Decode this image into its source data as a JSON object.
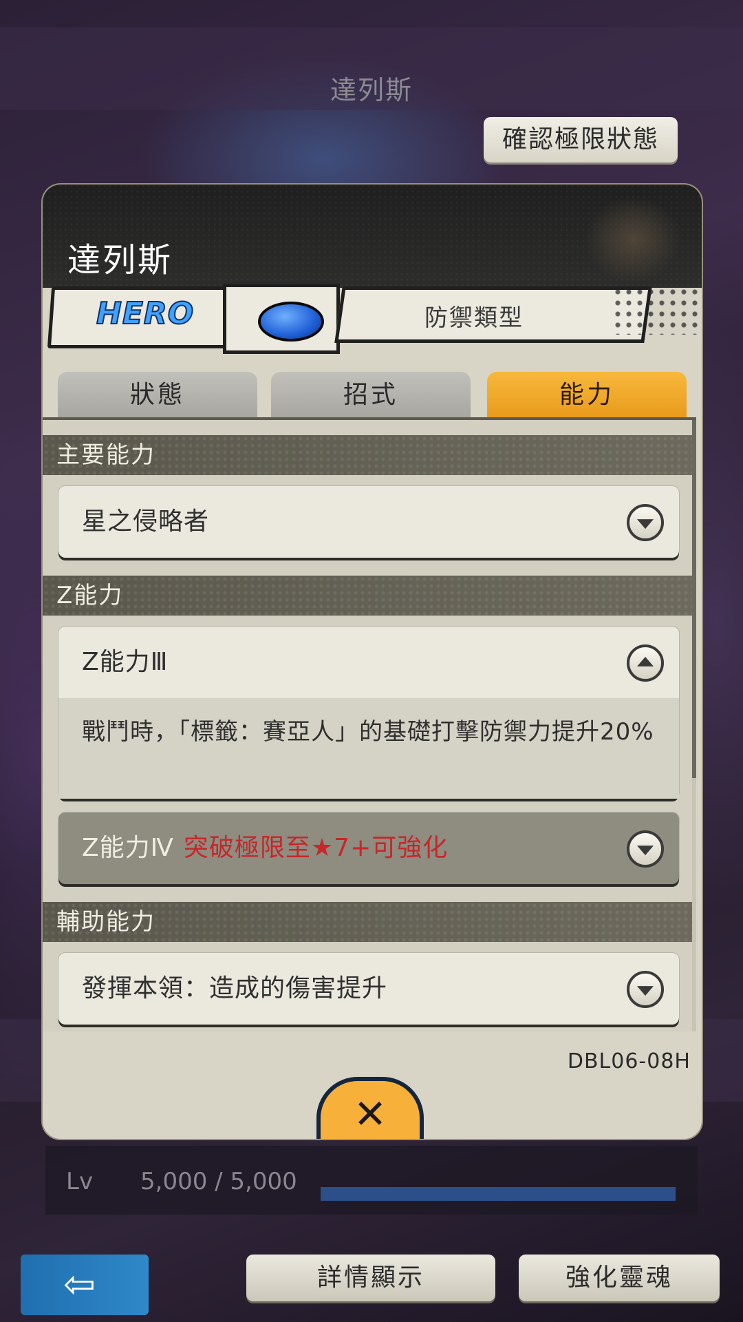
{
  "header": {
    "title": "達列斯",
    "confirm_limit_label": "確認極限狀態"
  },
  "panel": {
    "hero_name": "達列斯",
    "rarity_badge": "HERO",
    "type_label": "防禦類型",
    "type_color": "#2f6fe0",
    "tabs": [
      {
        "label": "狀態",
        "active": false
      },
      {
        "label": "招式",
        "active": false
      },
      {
        "label": "能力",
        "active": true
      }
    ],
    "sections": {
      "main_ability": {
        "title": "主要能力",
        "item": "星之侵略者"
      },
      "z_ability": {
        "title": "Z能力",
        "item3_title": "Z能力Ⅲ",
        "item3_desc": "戰鬥時，「標籤：賽亞人」的基礎打擊防禦力提升20%",
        "item4_title": "Z能力Ⅳ",
        "item4_lock": "突破極限至★7+可強化"
      },
      "support_ability": {
        "title": "輔助能力",
        "item": "發揮本領：造成的傷害提升"
      }
    },
    "card_code": "DBL06-08H",
    "close_icon": "✕"
  },
  "level": {
    "label": "Lv",
    "value": "5,000 / 5,000",
    "progress": 1.0
  },
  "bottom_nav": {
    "back_icon": "⇦",
    "details_label": "詳情顯示",
    "soul_label": "強化靈魂"
  },
  "colors": {
    "accent": "#f0a52a",
    "lock_red": "#c6272a"
  }
}
